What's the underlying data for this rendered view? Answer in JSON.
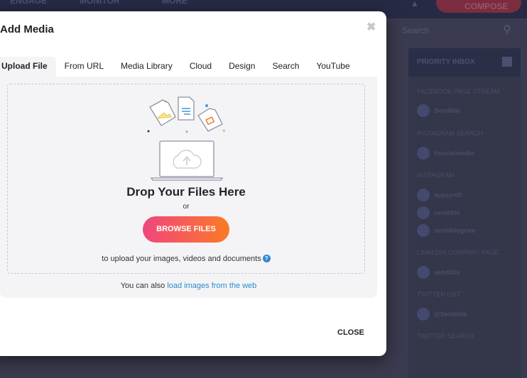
{
  "background": {
    "nav": [
      "ENGAGE",
      "MONITOR",
      "MORE"
    ],
    "compose_label": "COMPOSE",
    "search_placeholder": "Search",
    "priority_inbox": "PRIORITY INBOX",
    "sections": [
      {
        "title": "FACEBOOK PAGE STREAM",
        "items": [
          "Sendible"
        ]
      },
      {
        "title": "INSTAGRAM SEARCH",
        "items": [
          "#socialmedia"
        ]
      },
      {
        "title": "INSTAGRAM",
        "items": [
          "appsynth",
          "sendible",
          "sendiblegram"
        ]
      },
      {
        "title": "LINKEDIN COMPANY PAGE",
        "items": [
          "sendible"
        ]
      },
      {
        "title": "TWITTER LIST",
        "items": [
          "@Sendible"
        ]
      },
      {
        "title": "TWITTER SEARCH",
        "items": []
      }
    ]
  },
  "modal": {
    "title": "Add Media",
    "tabs": [
      "Upload File",
      "From URL",
      "Media Library",
      "Cloud",
      "Design",
      "Search",
      "YouTube"
    ],
    "active_tab": "Upload File",
    "drop_heading": "Drop Your Files Here",
    "or": "or",
    "browse_label": "BROWSE FILES",
    "upload_hint": "to upload your images, videos and documents",
    "also_prefix": "You can also",
    "also_link": "load images from the web",
    "close_label": "CLOSE"
  },
  "colors": {
    "accent_start": "#f0457e",
    "accent_end": "#fb7a26",
    "link": "#2a8ccb"
  }
}
